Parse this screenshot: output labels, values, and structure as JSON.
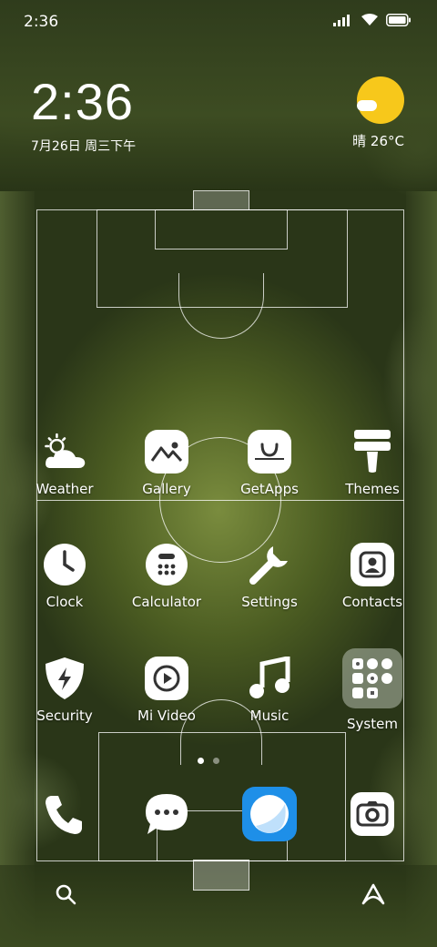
{
  "status_bar": {
    "time": "2:36",
    "icons": [
      "signal-icon",
      "wifi-icon",
      "battery-icon"
    ]
  },
  "clock_widget": {
    "time": "2:36",
    "date": "7月26日 周三下午"
  },
  "weather_widget": {
    "temp": "晴 26°C",
    "icon": "sun-cloud-icon"
  },
  "apps": [
    {
      "label": "Weather",
      "icon": "weather-icon"
    },
    {
      "label": "Gallery",
      "icon": "gallery-icon"
    },
    {
      "label": "GetApps",
      "icon": "getapps-icon"
    },
    {
      "label": "Themes",
      "icon": "themes-icon"
    },
    {
      "label": "Clock",
      "icon": "clock-icon"
    },
    {
      "label": "Calculator",
      "icon": "calculator-icon"
    },
    {
      "label": "Settings",
      "icon": "settings-icon"
    },
    {
      "label": "Contacts",
      "icon": "contacts-icon"
    },
    {
      "label": "Security",
      "icon": "security-icon"
    },
    {
      "label": "Mi Video",
      "icon": "video-icon"
    },
    {
      "label": "Music",
      "icon": "music-icon"
    },
    {
      "label": "System",
      "icon": "system-folder-icon"
    }
  ],
  "page_indicator": {
    "pages": 2,
    "active": 1
  },
  "dock": [
    "phone-icon",
    "messages-icon",
    "browser-icon",
    "camera-icon"
  ],
  "bottom_bar": [
    "search-icon",
    "assistant-icon"
  ],
  "colors": {
    "sun": "#f7c81b",
    "browser": "#1e8fe8",
    "text": "#ffffff"
  }
}
